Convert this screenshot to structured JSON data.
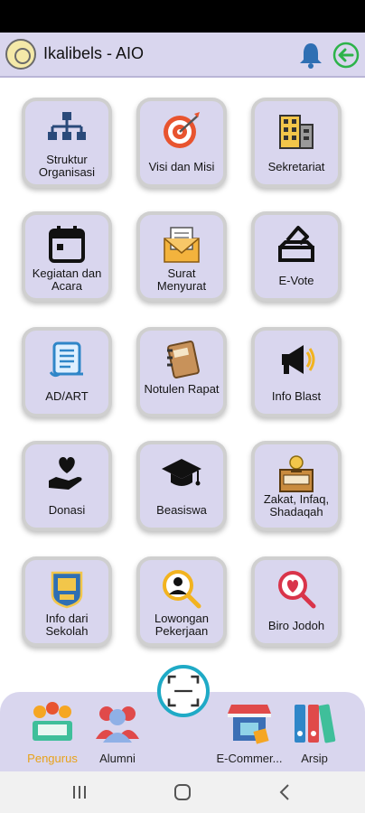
{
  "app": {
    "title": "Ikalibels - AIO",
    "colors": {
      "appbar": "#d9d6ee",
      "accent_green": "#2db34a",
      "bell_blue": "#2f6fb3",
      "scan_ring": "#1faac6",
      "active_nav": "#e8a21a"
    }
  },
  "header": {
    "logo_icon": "school-emblem-logo",
    "bell_icon": "bell-icon",
    "back_icon": "back-arrow-icon"
  },
  "menu": [
    {
      "label": "Struktur Organisasi",
      "icon": "org-chart-icon"
    },
    {
      "label": "Visi dan Misi",
      "icon": "target-icon"
    },
    {
      "label": "Sekretariat",
      "icon": "building-icon"
    },
    {
      "label": "Kegiatan dan Acara",
      "icon": "calendar-icon"
    },
    {
      "label": "Surat Menyurat",
      "icon": "envelope-icon"
    },
    {
      "label": "E-Vote",
      "icon": "ballot-box-icon"
    },
    {
      "label": "AD/ART",
      "icon": "scroll-document-icon"
    },
    {
      "label": "Notulen Rapat",
      "icon": "notebook-icon"
    },
    {
      "label": "Info Blast",
      "icon": "megaphone-icon"
    },
    {
      "label": "Donasi",
      "icon": "heart-hand-icon"
    },
    {
      "label": "Beasiswa",
      "icon": "graduation-cap-icon"
    },
    {
      "label": "Zakat, Infaq, Shadaqah",
      "icon": "zakat-box-icon"
    },
    {
      "label": "Info dari Sekolah",
      "icon": "school-badge-icon"
    },
    {
      "label": "Lowongan Pekerjaan",
      "icon": "job-search-icon"
    },
    {
      "label": "Biro Jodoh",
      "icon": "heart-search-icon"
    }
  ],
  "bottom_nav": [
    {
      "label": "Pengurus",
      "icon": "board-members-icon",
      "active": true
    },
    {
      "label": "Alumni",
      "icon": "alumni-group-icon",
      "active": false
    },
    {
      "label": "E-Commer...",
      "icon": "shop-icon",
      "active": false
    },
    {
      "label": "Arsip",
      "icon": "binders-icon",
      "active": false
    }
  ],
  "scan_button": {
    "icon": "scan-frame-icon"
  },
  "system_nav": {
    "recents_icon": "recents-icon",
    "home_icon": "home-icon",
    "back_icon": "system-back-icon"
  }
}
